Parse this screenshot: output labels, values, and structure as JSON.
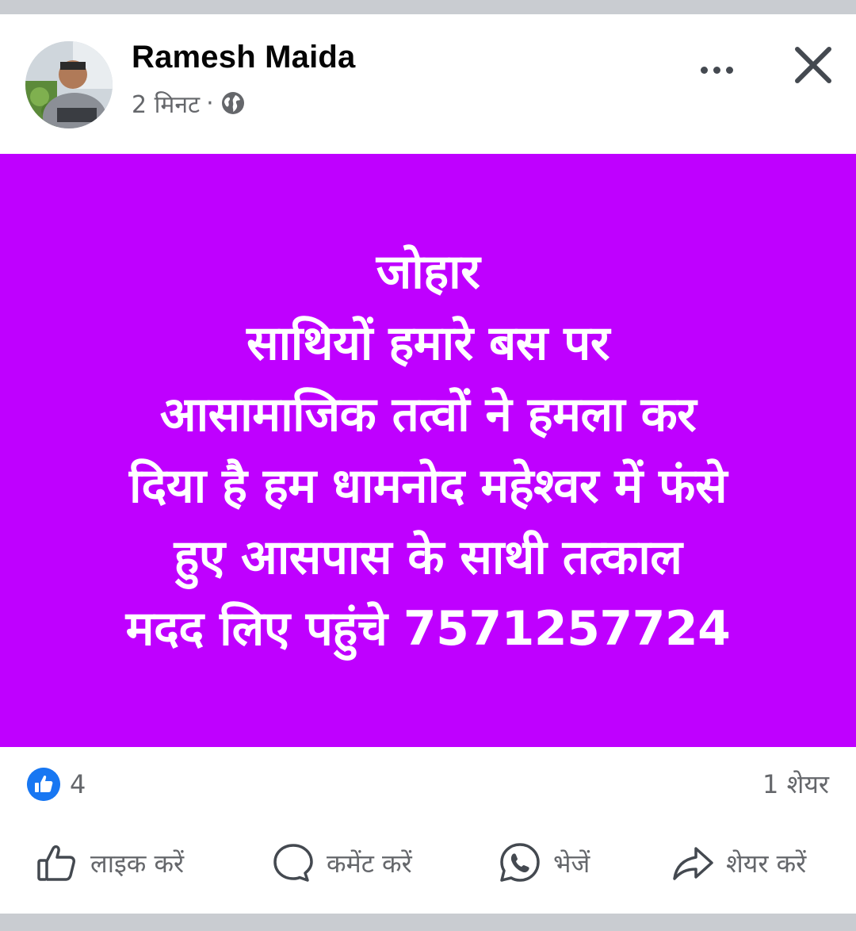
{
  "post": {
    "author_name": "Ramesh Maida",
    "time_ago": "2 मिनट",
    "separator": "·",
    "privacy_icon": "globe-icon",
    "more_icon": "more-horizontal-icon",
    "close_icon": "close-icon",
    "background_color": "#bf00ff",
    "text_color": "#ffffff",
    "body_lines": [
      "जोहार",
      "साथियों हमारे बस पर",
      "आसामाजिक तत्वों ने हमला कर",
      "दिया है हम धामनोद महेश्वर में फंसे",
      "हुए आसपास के साथी तत्काल",
      "मदद लिए पहुंचे 7571257724"
    ]
  },
  "stats": {
    "reaction_icon": "like-reaction-icon",
    "reaction_count": "4",
    "share_count": "1 शेयर"
  },
  "actions": {
    "like_label": "लाइक करें",
    "comment_label": "कमेंट करें",
    "send_label": "भेजें",
    "share_label": "शेयर करें"
  },
  "colors": {
    "accent": "#1877f2",
    "secondary_text": "#65676b"
  }
}
